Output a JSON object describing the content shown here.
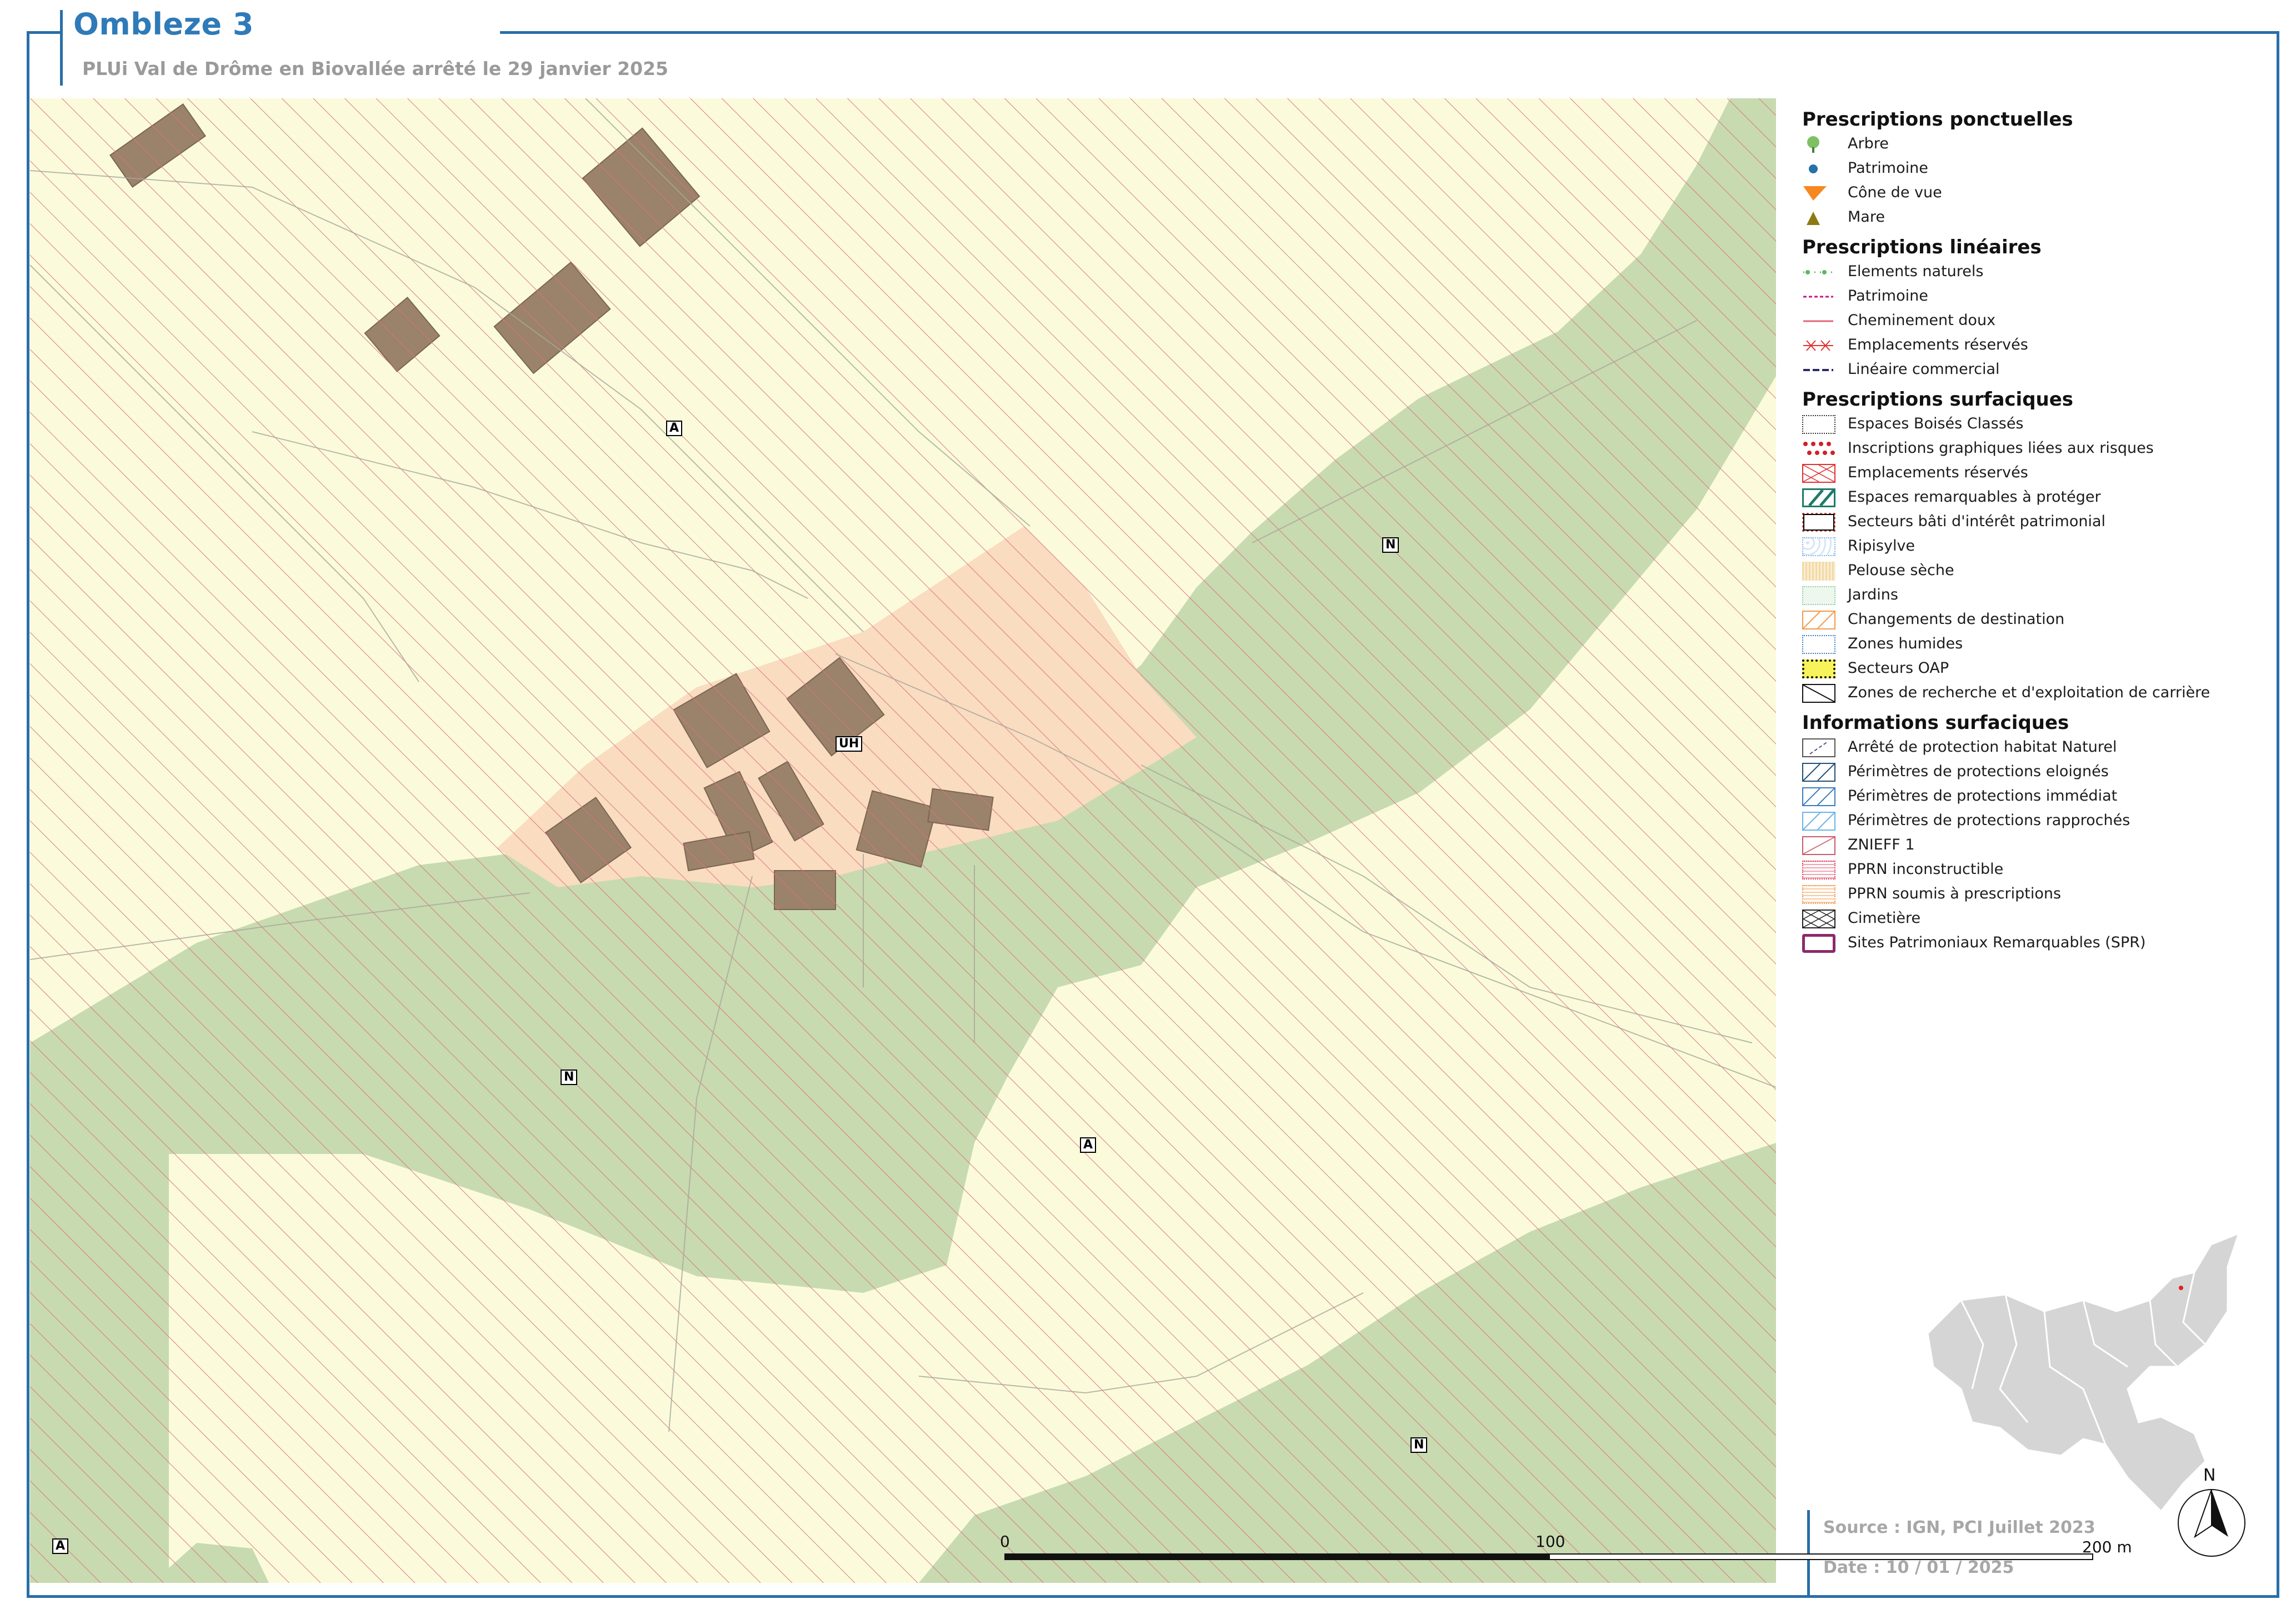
{
  "header": {
    "title": "Ombleze 3",
    "subtitle": "PLUi Val de Drôme en Biovallée arrêté le 29 janvier 2025"
  },
  "map": {
    "zone_labels": [
      "A",
      "N",
      "UH",
      "N",
      "A",
      "N",
      "A"
    ],
    "colors": {
      "zone_A": "#fbfbdc",
      "zone_N": "#c8dab0",
      "zone_UH": "#fadcc0",
      "building": "#9b826a",
      "hatch": "#d9757f",
      "border": "#2a6fa8"
    }
  },
  "legend": {
    "ponctuelles_title": "Prescriptions ponctuelles",
    "ponctuelles": [
      {
        "label": "Arbre",
        "icon": "tree-icon"
      },
      {
        "label": "Patrimoine",
        "icon": "heritage-dot-icon"
      },
      {
        "label": "Cône de vue",
        "icon": "view-cone-icon"
      },
      {
        "label": "Mare",
        "icon": "pond-triangle-icon"
      }
    ],
    "lineaires_title": "Prescriptions linéaires",
    "lineaires": [
      {
        "label": "Elements naturels"
      },
      {
        "label": "Patrimoine"
      },
      {
        "label": "Cheminement doux"
      },
      {
        "label": "Emplacements réservés"
      },
      {
        "label": "Linéaire commercial"
      }
    ],
    "surfaciques_title": "Prescriptions surfaciques",
    "surfaciques": [
      {
        "label": "Espaces Boisés Classés"
      },
      {
        "label": "Inscriptions graphiques liées aux risques"
      },
      {
        "label": "Emplacements réservés"
      },
      {
        "label": "Espaces remarquables à protéger"
      },
      {
        "label": "Secteurs bâti d'intérêt patrimonial"
      },
      {
        "label": "Ripisylve"
      },
      {
        "label": "Pelouse sèche"
      },
      {
        "label": "Jardins"
      },
      {
        "label": "Changements de destination"
      },
      {
        "label": "Zones humides"
      },
      {
        "label": "Secteurs OAP"
      },
      {
        "label": "Zones de recherche et d'exploitation de carrière"
      }
    ],
    "informations_title": "Informations surfaciques",
    "informations": [
      {
        "label": "Arrêté de protection habitat Naturel"
      },
      {
        "label": "Périmètres de protections eloignés"
      },
      {
        "label": "Périmètres de protections immédiat"
      },
      {
        "label": "Périmètres de protections rapprochés"
      },
      {
        "label": "ZNIEFF 1"
      },
      {
        "label": "PPRN inconstructible"
      },
      {
        "label": "PPRN soumis à prescriptions"
      },
      {
        "label": "Cimetière"
      },
      {
        "label": "Sites Patrimoniaux Remarquables (SPR)"
      }
    ]
  },
  "footer": {
    "source": "Source : IGN, PCI Juillet 2023",
    "date": "Date : 10 / 01 / 2025",
    "scale_0": "0",
    "scale_100": "100",
    "scale_200": "200 m",
    "north": "N"
  }
}
